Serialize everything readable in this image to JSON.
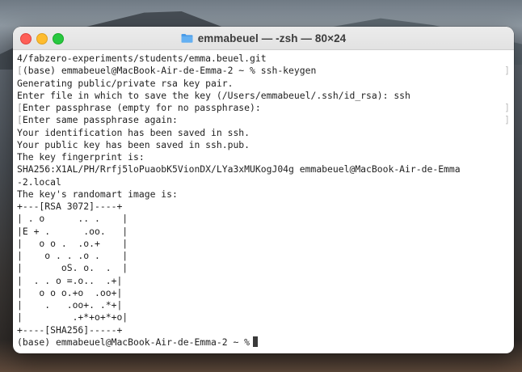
{
  "window": {
    "title": "emmabeuel — -zsh — 80×24"
  },
  "icons": {
    "title_icon": "folder-icon"
  },
  "colors": {
    "close": "#fe5f57",
    "minimize": "#febc2e",
    "maximize": "#28c840",
    "folder": "#4a9be8"
  },
  "terminal": {
    "lines": [
      {
        "text": "4/fabzero-experiments/students/emma.beuel.git",
        "mark": false
      },
      {
        "text": "(base) emmabeuel@MacBook-Air-de-Emma-2 ~ % ssh-keygen",
        "mark": true
      },
      {
        "text": "Generating public/private rsa key pair.",
        "mark": false
      },
      {
        "text": "Enter file in which to save the key (/Users/emmabeuel/.ssh/id_rsa): ssh",
        "mark": false
      },
      {
        "text": "Enter passphrase (empty for no passphrase):",
        "mark": true
      },
      {
        "text": "Enter same passphrase again:",
        "mark": true
      },
      {
        "text": "Your identification has been saved in ssh.",
        "mark": false
      },
      {
        "text": "Your public key has been saved in ssh.pub.",
        "mark": false
      },
      {
        "text": "The key fingerprint is:",
        "mark": false
      },
      {
        "text": "SHA256:X1AL/PH/Rrfj5loPuaobK5VionDX/LYa3xMUKogJ04g emmabeuel@MacBook-Air-de-Emma",
        "mark": false
      },
      {
        "text": "-2.local",
        "mark": false
      },
      {
        "text": "The key's randomart image is:",
        "mark": false
      },
      {
        "text": "+---[RSA 3072]----+",
        "mark": false
      },
      {
        "text": "| . o      .. .    |",
        "mark": false
      },
      {
        "text": "|E + .      .oo.   |",
        "mark": false
      },
      {
        "text": "|   o o .  .o.+    |",
        "mark": false
      },
      {
        "text": "|    o . . .o .    |",
        "mark": false
      },
      {
        "text": "|       oS. o.  .  |",
        "mark": false
      },
      {
        "text": "|  . . o =.o..  .+|",
        "mark": false
      },
      {
        "text": "|   o o o.+o  .oo+|",
        "mark": false
      },
      {
        "text": "|    .   .oo+. .*+|",
        "mark": false
      },
      {
        "text": "|         .+*+o+*+o|",
        "mark": false
      },
      {
        "text": "+----[SHA256]-----+",
        "mark": false
      },
      {
        "text": "(base) emmabeuel@MacBook-Air-de-Emma-2 ~ %",
        "mark": false,
        "cursor": true
      }
    ],
    "left_mark": "[",
    "right_mark": "]"
  }
}
